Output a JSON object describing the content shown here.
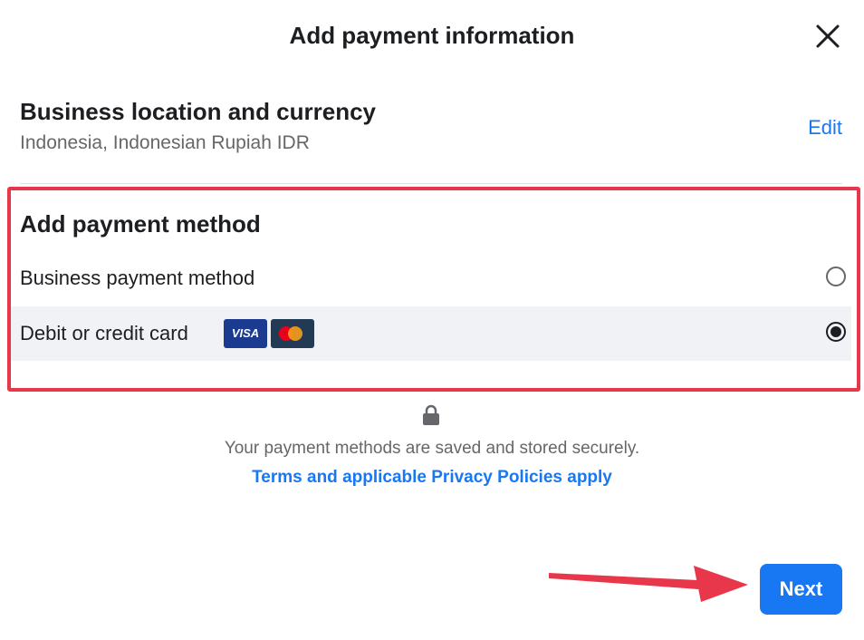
{
  "dialog": {
    "title": "Add payment information",
    "close_icon": "close-icon"
  },
  "business_location": {
    "heading": "Business location and currency",
    "value": "Indonesia, Indonesian Rupiah IDR",
    "edit_label": "Edit"
  },
  "payment_method": {
    "heading": "Add payment method",
    "options": [
      {
        "label": "Business payment method",
        "selected": false
      },
      {
        "label": "Debit or credit card",
        "selected": true,
        "cards": [
          "VISA",
          "mastercard"
        ]
      }
    ]
  },
  "security": {
    "icon": "lock-icon",
    "message": "Your payment methods are saved and stored securely.",
    "terms_link": "Terms and applicable Privacy Policies apply"
  },
  "footer": {
    "next_label": "Next"
  },
  "colors": {
    "accent": "#1877f2",
    "highlight_border": "#e8374b",
    "arrow": "#e8374b",
    "selected_row_bg": "#f0f2f5"
  }
}
